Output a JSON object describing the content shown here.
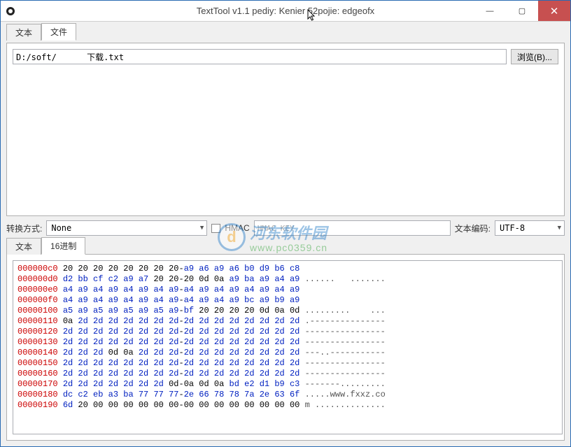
{
  "window": {
    "title": "TextTool v1.1 pediy: Kenier 52pojie: edgeofx"
  },
  "watermark": {
    "line1": "河东软件园",
    "line2": "www.pc0359.cn"
  },
  "tabs_top": {
    "text": "文本",
    "file": "文件",
    "active": "file"
  },
  "file": {
    "path": "D:/soft/      下载.txt",
    "browse": "浏览(B)..."
  },
  "conv": {
    "label": "转换方式:",
    "method": "None",
    "hmac_on": false,
    "hmac_label": "HMAC",
    "hmac_key_placeholder": "HMAC KEY",
    "enc_label": "文本编码:",
    "encoding": "UTF-8"
  },
  "tabs_bottom": {
    "text": "文本",
    "hex": "16进制",
    "active": "hex"
  },
  "hex_lines": [
    {
      "off": "000000c0",
      "bytes": [
        "20",
        "20",
        "20",
        "20",
        "20",
        "20",
        "20",
        "20-a9",
        "a6",
        "a9",
        "a6",
        "b0",
        "d9",
        "b6",
        "c8"
      ],
      "ascii": ""
    },
    {
      "off": "000000d0",
      "bytes": [
        "d2",
        "bb",
        "cf",
        "c2",
        "a9",
        "a7",
        "20",
        "20-20",
        "0d",
        "0a",
        "a9",
        "ba",
        "a9",
        "a4",
        "a9"
      ],
      "ascii": "......   ......."
    },
    {
      "off": "000000e0",
      "bytes": [
        "a4",
        "a9",
        "a4",
        "a9",
        "a4",
        "a9",
        "a4",
        "a9-a4",
        "a9",
        "a4",
        "a9",
        "a4",
        "a9",
        "a4",
        "a9"
      ],
      "ascii": ""
    },
    {
      "off": "000000f0",
      "bytes": [
        "a4",
        "a9",
        "a4",
        "a9",
        "a4",
        "a9",
        "a4",
        "a9-a4",
        "a9",
        "a4",
        "a9",
        "bc",
        "a9",
        "b9",
        "a9"
      ],
      "ascii": ""
    },
    {
      "off": "00000100",
      "bytes": [
        "a5",
        "a9",
        "a5",
        "a9",
        "a5",
        "a9",
        "a5",
        "a9-bf",
        "20",
        "20",
        "20",
        "20",
        "0d",
        "0a",
        "0d"
      ],
      "ascii": ".........    ..."
    },
    {
      "off": "00000110",
      "bytes": [
        "0a",
        "2d",
        "2d",
        "2d",
        "2d",
        "2d",
        "2d",
        "2d-2d",
        "2d",
        "2d",
        "2d",
        "2d",
        "2d",
        "2d",
        "2d"
      ],
      "ascii": ".---------------"
    },
    {
      "off": "00000120",
      "bytes": [
        "2d",
        "2d",
        "2d",
        "2d",
        "2d",
        "2d",
        "2d",
        "2d-2d",
        "2d",
        "2d",
        "2d",
        "2d",
        "2d",
        "2d",
        "2d"
      ],
      "ascii": "----------------"
    },
    {
      "off": "00000130",
      "bytes": [
        "2d",
        "2d",
        "2d",
        "2d",
        "2d",
        "2d",
        "2d",
        "2d-2d",
        "2d",
        "2d",
        "2d",
        "2d",
        "2d",
        "2d",
        "2d"
      ],
      "ascii": "----------------"
    },
    {
      "off": "00000140",
      "bytes": [
        "2d",
        "2d",
        "2d",
        "0d",
        "0a",
        "2d",
        "2d",
        "2d-2d",
        "2d",
        "2d",
        "2d",
        "2d",
        "2d",
        "2d",
        "2d"
      ],
      "ascii": "---..-----------"
    },
    {
      "off": "00000150",
      "bytes": [
        "2d",
        "2d",
        "2d",
        "2d",
        "2d",
        "2d",
        "2d",
        "2d-2d",
        "2d",
        "2d",
        "2d",
        "2d",
        "2d",
        "2d",
        "2d"
      ],
      "ascii": "----------------"
    },
    {
      "off": "00000160",
      "bytes": [
        "2d",
        "2d",
        "2d",
        "2d",
        "2d",
        "2d",
        "2d",
        "2d-2d",
        "2d",
        "2d",
        "2d",
        "2d",
        "2d",
        "2d",
        "2d"
      ],
      "ascii": "----------------"
    },
    {
      "off": "00000170",
      "bytes": [
        "2d",
        "2d",
        "2d",
        "2d",
        "2d",
        "2d",
        "2d",
        "0d-0a",
        "0d",
        "0a",
        "bd",
        "e2",
        "d1",
        "b9",
        "c3"
      ],
      "ascii": "-------........."
    },
    {
      "off": "00000180",
      "bytes": [
        "dc",
        "c2",
        "eb",
        "a3",
        "ba",
        "77",
        "77",
        "77-2e",
        "66",
        "78",
        "78",
        "7a",
        "2e",
        "63",
        "6f"
      ],
      "ascii": ".....www.fxxz.co"
    },
    {
      "off": "00000190",
      "bytes": [
        "6d",
        "20",
        "00",
        "00",
        "00",
        "00",
        "00",
        "00-00",
        "00",
        "00",
        "00",
        "00",
        "00",
        "00",
        "00"
      ],
      "ascii": "m .............."
    }
  ]
}
